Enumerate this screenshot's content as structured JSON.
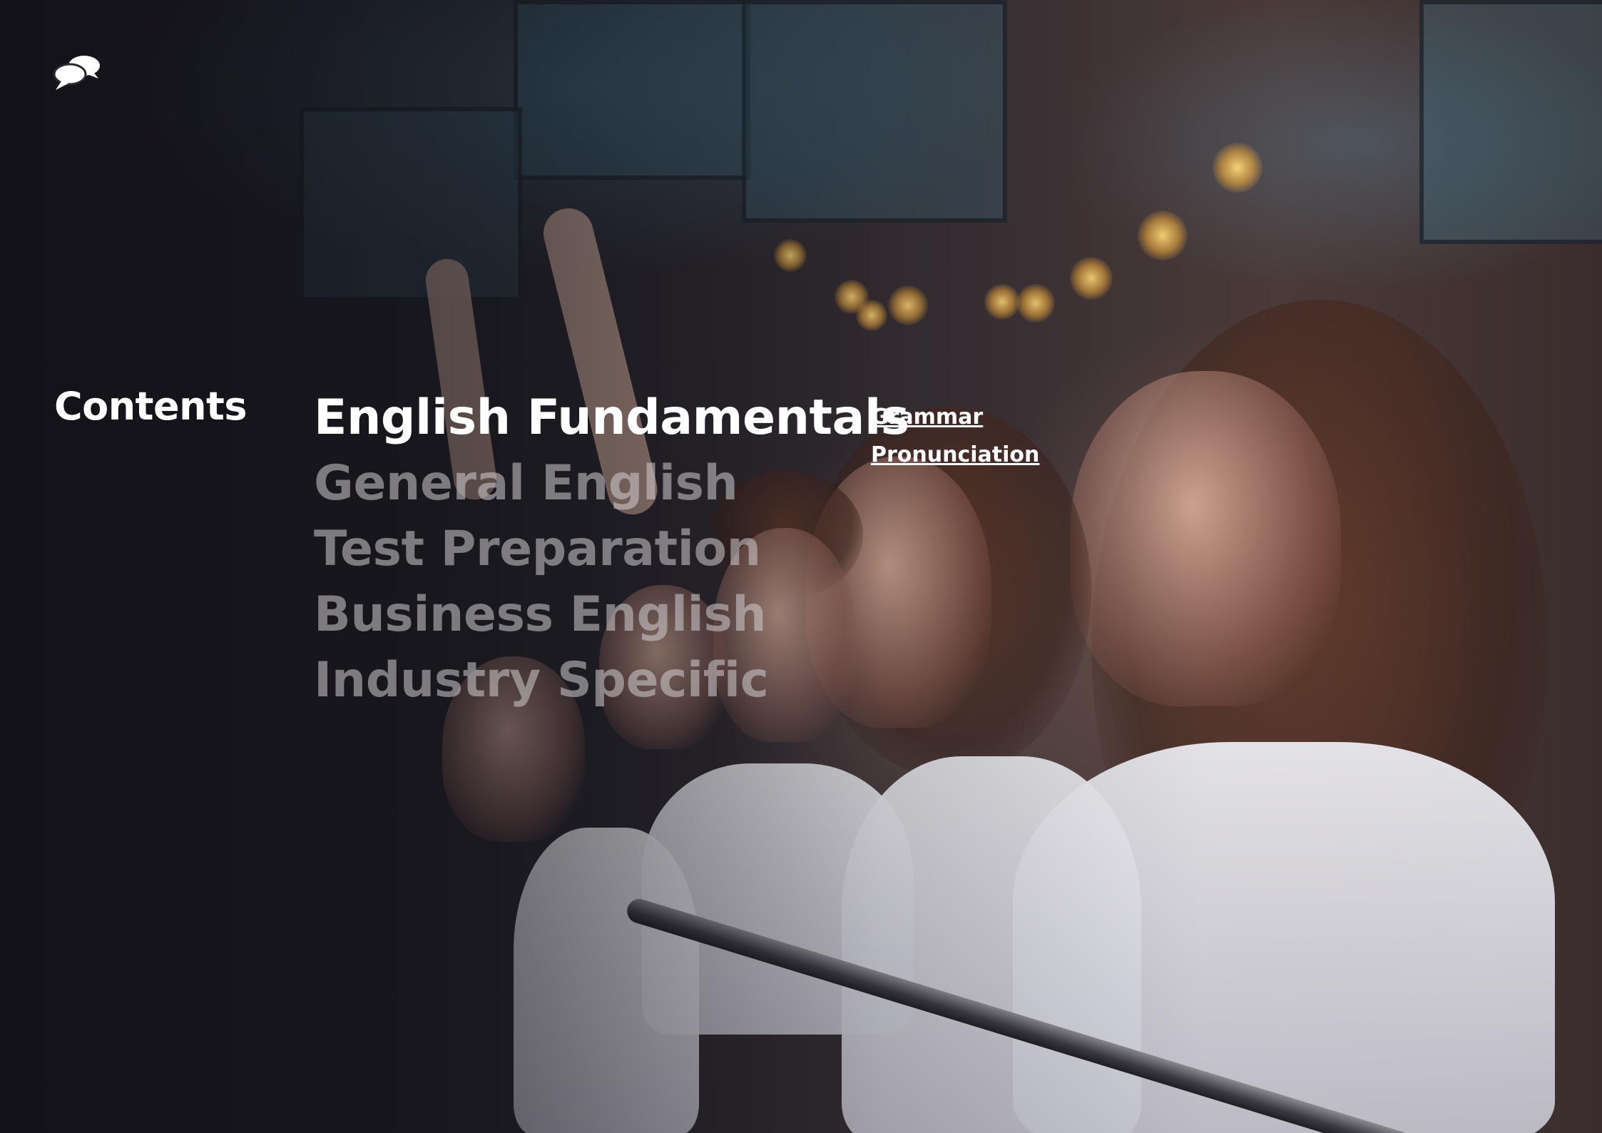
{
  "logo": {
    "icon": "speech-bubbles-icon"
  },
  "contents_title": "Contents",
  "menu": {
    "items": [
      {
        "label": "English Fundamentals",
        "active": true
      },
      {
        "label": "General English",
        "active": false
      },
      {
        "label": "Test Preparation",
        "active": false
      },
      {
        "label": "Business English",
        "active": false
      },
      {
        "label": "Industry Specific",
        "active": false
      }
    ]
  },
  "submenu": {
    "items": [
      {
        "label": "Grammar"
      },
      {
        "label": "Pronunciation"
      }
    ]
  },
  "colors": {
    "active_text": "#ffffff",
    "inactive_text": "#d2cdd2"
  }
}
